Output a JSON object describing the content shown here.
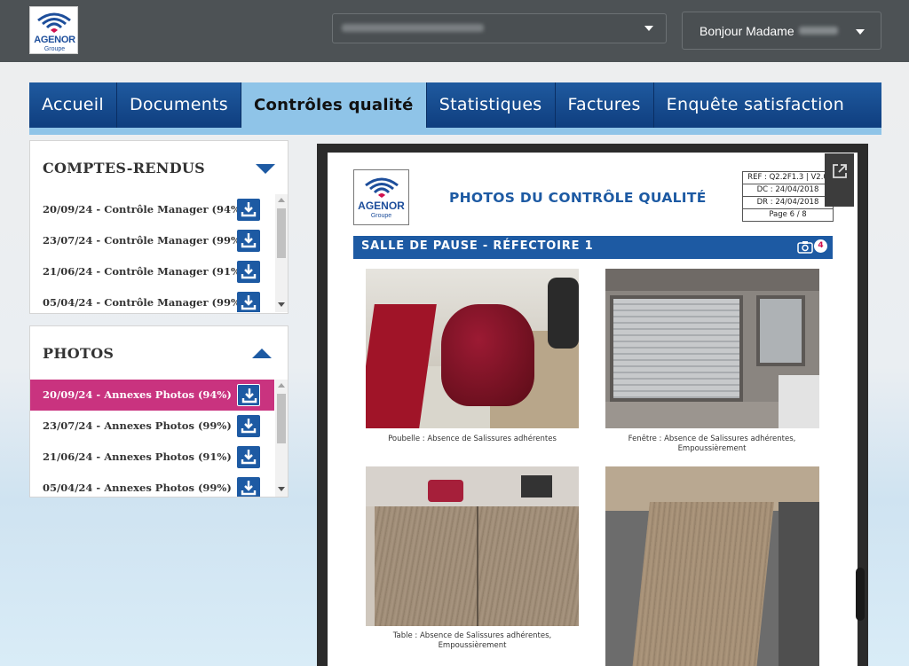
{
  "header": {
    "logo_name": "AGENOR",
    "logo_sub": "Groupe",
    "site_selector_value": "AGELR VILLENEUVE D ASCQ",
    "greeting": "Bonjour Madame",
    "greeting_name": "Delhalle"
  },
  "nav": {
    "items": [
      {
        "label": "Accueil"
      },
      {
        "label": "Documents"
      },
      {
        "label": "Contrôles qualité",
        "active": true
      },
      {
        "label": "Statistiques"
      },
      {
        "label": "Factures"
      },
      {
        "label": "Enquête satisfaction"
      }
    ]
  },
  "reports_panel": {
    "title": "COMPTES-RENDUS",
    "items": [
      {
        "label": "20/09/24 - Contrôle Manager (94%)"
      },
      {
        "label": "23/07/24 - Contrôle Manager (99%)"
      },
      {
        "label": "21/06/24 - Contrôle Manager (91%)"
      },
      {
        "label": "05/04/24 - Contrôle Manager (99%)"
      }
    ]
  },
  "photos_panel": {
    "title": "PHOTOS",
    "items": [
      {
        "label": "20/09/24 - Annexes Photos (94%)",
        "selected": true
      },
      {
        "label": "23/07/24 - Annexes Photos (99%)"
      },
      {
        "label": "21/06/24 - Annexes Photos (91%)"
      },
      {
        "label": "05/04/24 - Annexes Photos (99%)"
      }
    ]
  },
  "document": {
    "logo_name": "AGENOR",
    "logo_sub": "Groupe",
    "title": "PHOTOS DU CONTRÔLE QUALITÉ",
    "ref": "REF : Q2.2F1.3 | V2.0",
    "dc": "DC : 24/04/2018",
    "dr": "DR : 24/04/2018",
    "page": "Page 6 / 8",
    "section": "SALLE DE PAUSE - RÉFECTOIRE 1",
    "photo_count": "4",
    "captions": {
      "photo1": "Poubelle : Absence de Salissures adhérentes",
      "photo2_line1": "Fenêtre : Absence de Salissures adhérentes,",
      "photo2_line2": "Empoussièrement",
      "photo3_line1": "Table : Absence de Salissures adhérentes,",
      "photo3_line2": "Empoussièrement"
    }
  },
  "colors": {
    "header_bg": "#4d5255",
    "nav_blue": "#1d5aa3",
    "nav_active": "#8fc4e8",
    "selected_row": "#c9337f"
  }
}
